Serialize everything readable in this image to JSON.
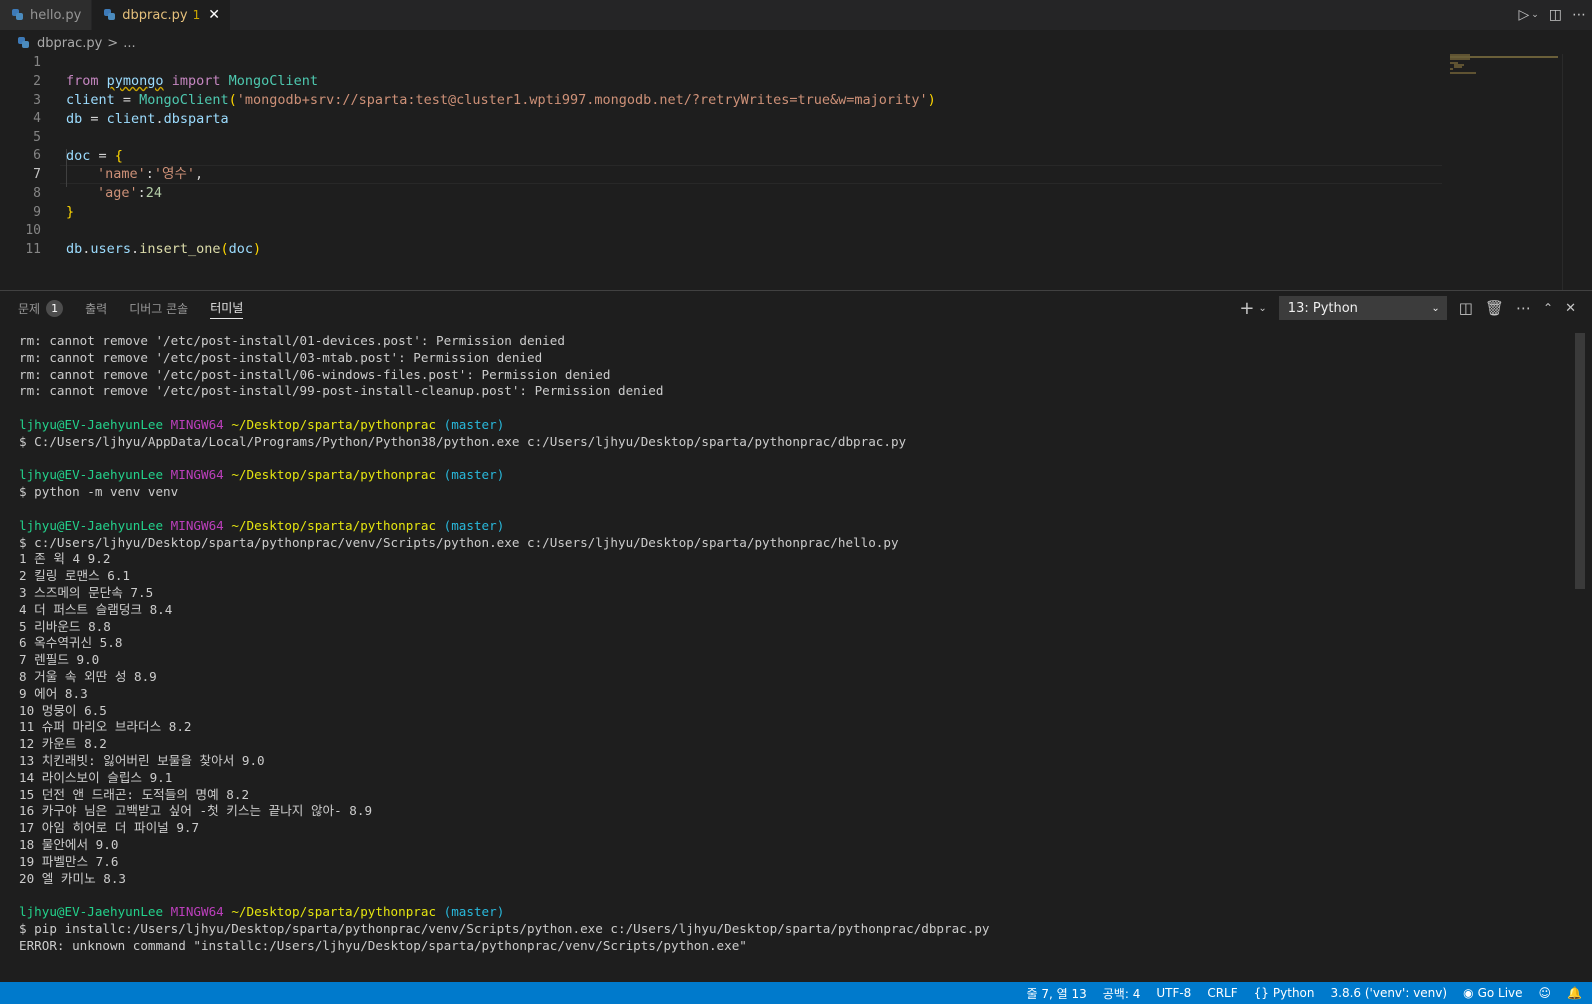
{
  "tabs": [
    {
      "label": "hello.py",
      "active": false
    },
    {
      "label": "dbprac.py",
      "badge": "1",
      "active": true
    }
  ],
  "breadcrumb": {
    "file": "dbprac.py",
    "sep": ">",
    "more": "..."
  },
  "editor": {
    "line_numbers": [
      "1",
      "2",
      "3",
      "4",
      "5",
      "6",
      "7",
      "8",
      "9",
      "10",
      "11"
    ],
    "current_line": "7",
    "l1": {
      "from": "from",
      "module": "pymongo",
      "import": "import",
      "name": "MongoClient"
    },
    "l2": {
      "var": "client",
      "op": " = ",
      "cls": "MongoClient",
      "open": "(",
      "str": "'mongodb+srv://sparta:test@cluster1.wpti997.mongodb.net/?retryWrites=true&w=majority'",
      "close": ")"
    },
    "l3": {
      "var": "db",
      "op": " = ",
      "obj": "client",
      "dot": ".",
      "attr": "dbsparta"
    },
    "l5": {
      "var": "doc",
      "op": " = ",
      "brace": "{"
    },
    "l6": {
      "key": "'name'",
      "colon": ":",
      "val": "'영수'",
      "comma": ","
    },
    "l7": {
      "key": "'age'",
      "colon": ":",
      "val": "24"
    },
    "l8": {
      "brace": "}"
    },
    "l10": {
      "obj": "db",
      "dot1": ".",
      "attr": "users",
      "dot2": ".",
      "fn": "insert_one",
      "open": "(",
      "arg": "doc",
      "close": ")"
    }
  },
  "panel": {
    "tabs": [
      {
        "label": "문제",
        "badge": "1"
      },
      {
        "label": "출력"
      },
      {
        "label": "디버그 콘솔"
      },
      {
        "label": "터미널",
        "active": true
      }
    ],
    "terminal_select": "13: Python"
  },
  "terminal": {
    "rm_lines": [
      "rm: cannot remove '/etc/post-install/01-devices.post': Permission denied",
      "rm: cannot remove '/etc/post-install/03-mtab.post': Permission denied",
      "rm: cannot remove '/etc/post-install/06-windows-files.post': Permission denied",
      "rm: cannot remove '/etc/post-install/99-post-install-cleanup.post': Permission denied"
    ],
    "prompt": {
      "user": "ljhyu@EV-JaehyunLee",
      "sys": "MINGW64",
      "path": "~/Desktop/sparta/pythonprac",
      "branch": "(master)"
    },
    "cmd1": "$ C:/Users/ljhyu/AppData/Local/Programs/Python/Python38/python.exe c:/Users/ljhyu/Desktop/sparta/pythonprac/dbprac.py",
    "cmd2": "$ python -m venv venv",
    "cmd3": "$ c:/Users/ljhyu/Desktop/sparta/pythonprac/venv/Scripts/python.exe c:/Users/ljhyu/Desktop/sparta/pythonprac/hello.py",
    "output": [
      "1 존 윅 4 9.2",
      "2 킬링 로맨스 6.1",
      "3 스즈메의 문단속 7.5",
      "4 더 퍼스트 슬램덩크 8.4",
      "5 리바운드 8.8",
      "6 옥수역귀신 5.8",
      "7 렌필드 9.0",
      "8 거울 속 외딴 성 8.9",
      "9 에어 8.3",
      "10 멍뭉이 6.5",
      "11 슈퍼 마리오 브라더스 8.2",
      "12 카운트 8.2",
      "13 치킨래빗: 잃어버린 보물을 찾아서 9.0",
      "14 라이스보이 슬립스 9.1",
      "15 던전 앤 드래곤: 도적들의 명예 8.2",
      "16 카구야 님은 고백받고 싶어 -첫 키스는 끝나지 않아- 8.9",
      "17 아임 히어로 더 파이널 9.7",
      "18 물안에서 9.0",
      "19 파벨만스 7.6",
      "20 엘 카미노 8.3"
    ],
    "cmd4": "$ pip installc:/Users/ljhyu/Desktop/sparta/pythonprac/venv/Scripts/python.exe c:/Users/ljhyu/Desktop/sparta/pythonprac/dbprac.py",
    "error": "ERROR: unknown command \"installc:/Users/ljhyu/Desktop/sparta/pythonprac/venv/Scripts/python.exe\""
  },
  "statusbar": {
    "position": "줄 7, 열 13",
    "spaces": "공백: 4",
    "encoding": "UTF-8",
    "eol": "CRLF",
    "language": "Python",
    "interpreter": "3.8.6 ('venv': venv)",
    "golive": "Go Live"
  },
  "colors": {
    "accent": "#007acc",
    "editor_bg": "#1e1e1e",
    "prompt_green": "#23d18b",
    "prompt_purple": "#bc3fbc",
    "prompt_yellow": "#e5e510",
    "prompt_cyan": "#29b8db"
  }
}
